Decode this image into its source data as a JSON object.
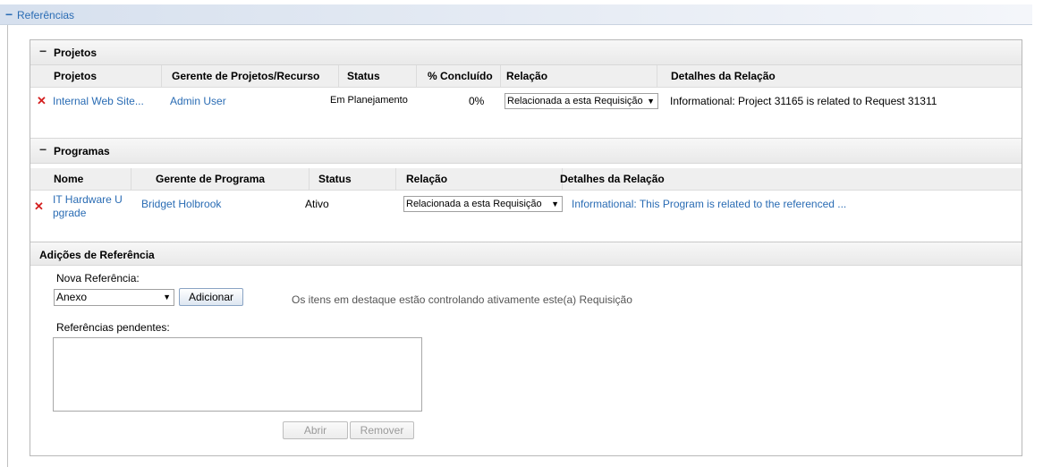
{
  "header": {
    "title": "Referências"
  },
  "projects": {
    "title": "Projetos",
    "columns": [
      "Projetos",
      "Gerente de Projetos/Recurso",
      "Status",
      "% Concluído",
      "Relação",
      "Detalhes da Relação"
    ],
    "rows": [
      {
        "name": "Internal Web Site...",
        "manager": "Admin User",
        "status": "Em Planejamento",
        "percent": "0%",
        "relation": "Relacionada a esta Requisição",
        "details": "Informational: Project 31165 is related to Request 31311"
      }
    ]
  },
  "programs": {
    "title": "Programas",
    "columns": [
      "Nome",
      "Gerente de Programa",
      "Status",
      "Relação",
      "Detalhes da Relação"
    ],
    "rows": [
      {
        "name_line1": "IT Hardware U",
        "name_line2": "pgrade",
        "manager": "Bridget Holbrook",
        "status": "Ativo",
        "relation": "Relacionada a esta Requisição",
        "details": "Informational: This Program is related to the referenced ..."
      }
    ]
  },
  "additions": {
    "title": "Adições de Referência",
    "new_ref_label": "Nova Referência:",
    "new_ref_value": "Anexo",
    "add_button": "Adicionar",
    "note": "Os itens em destaque estão controlando ativamente este(a) Requisição",
    "pending_label": "Referências pendentes:",
    "open_button": "Abrir",
    "remove_button": "Remover"
  },
  "colors": {
    "link": "#2a6cb4",
    "delete": "#d42020"
  }
}
